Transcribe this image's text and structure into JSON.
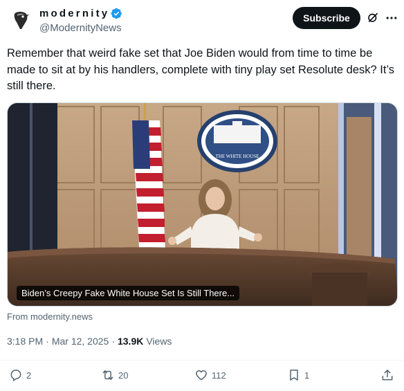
{
  "account": {
    "display_name": "modernity",
    "handle": "@ModernityNews",
    "verified_color": "#1d9bf0"
  },
  "header": {
    "subscribe_label": "Subscribe",
    "icons": [
      "grok-icon",
      "more-icon"
    ]
  },
  "tweet": {
    "text": "Remember that weird fake set that Joe Biden would from time to time be made to sit at by his handlers, complete with tiny play set Resolute desk? It’s still there."
  },
  "media": {
    "caption": "Biden’s Creepy Fake White House Set Is Still There...",
    "seal_text": "THE WHITE HOUSE",
    "source": "From modernity.news"
  },
  "meta": {
    "time": "3:18 PM",
    "separator": "·",
    "date": "Mar 12, 2025",
    "views_count": "13.9K",
    "views_label": "Views"
  },
  "actions": {
    "replies": "2",
    "reposts": "20",
    "likes": "112",
    "bookmarks": "1"
  },
  "colors": {
    "text": "#0f1419",
    "secondary": "#536471",
    "button_bg": "#0f1419"
  }
}
